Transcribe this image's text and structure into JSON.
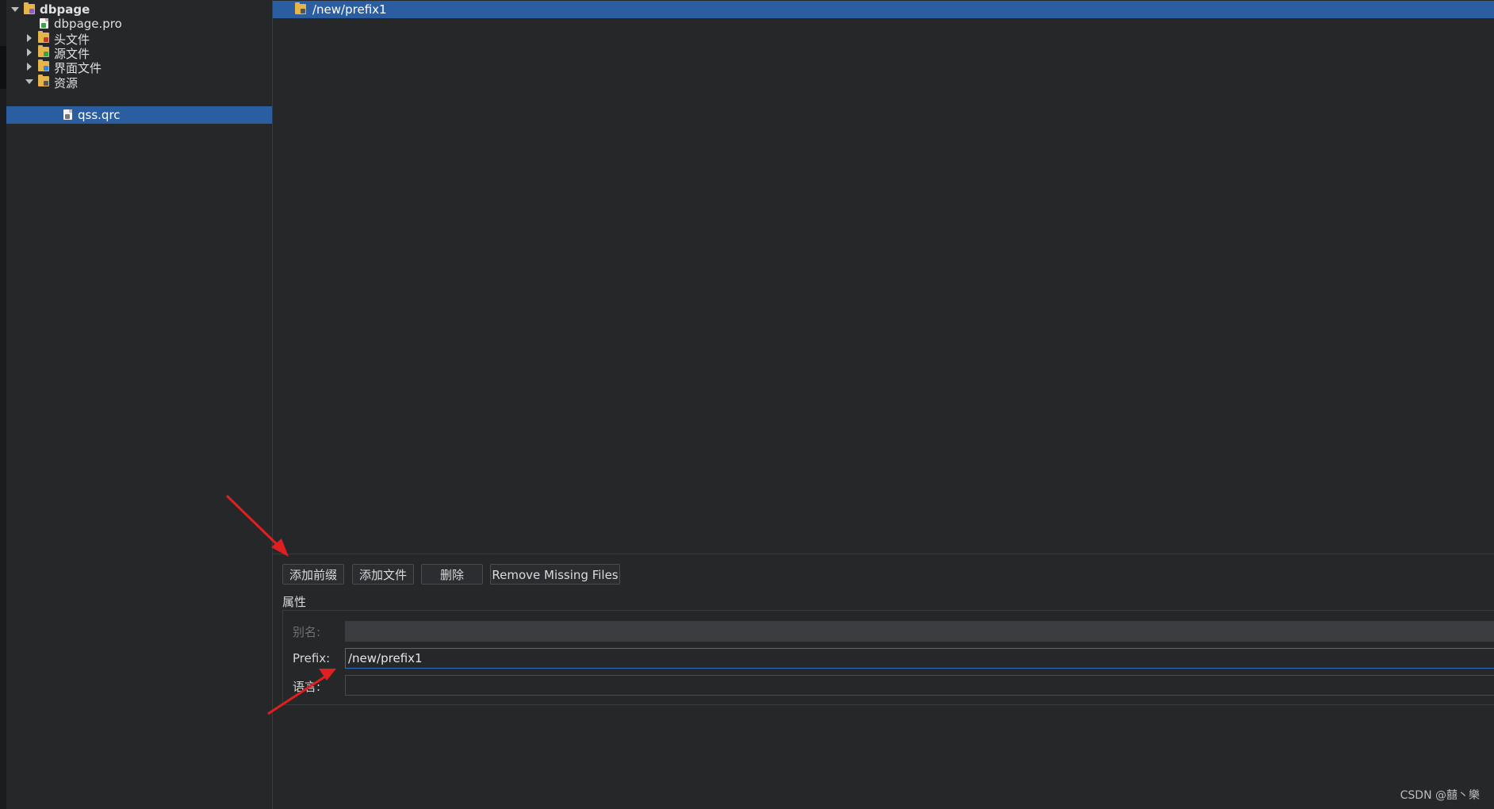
{
  "colors": {
    "accent": "#2b5ea0",
    "background": "#262729",
    "annotation": "#e02020"
  },
  "tree": {
    "items": [
      {
        "label": "dbpage",
        "expanded": true,
        "icon": "project-folder-icon"
      },
      {
        "label": "dbpage.pro",
        "icon": "pro-file-icon"
      },
      {
        "label": "头文件",
        "expanded": false,
        "icon": "headers-folder-icon"
      },
      {
        "label": "源文件",
        "expanded": false,
        "icon": "sources-folder-icon"
      },
      {
        "label": "界面文件",
        "expanded": false,
        "icon": "forms-folder-icon"
      },
      {
        "label": "资源",
        "expanded": true,
        "icon": "resources-folder-icon"
      },
      {
        "label": "qss.qrc",
        "selected": true,
        "icon": "qrc-file-icon"
      }
    ]
  },
  "resource_tree": {
    "prefix": "/new/prefix1"
  },
  "buttons": {
    "add_prefix": "添加前缀",
    "add_files": "添加文件",
    "delete": "删除",
    "remove_missing": "Remove Missing Files"
  },
  "properties": {
    "title": "属性",
    "alias_label": "别名:",
    "alias_value": "",
    "prefix_label": "Prefix:",
    "prefix_value": "/new/prefix1",
    "language_label": "语言:",
    "language_value": ""
  },
  "watermark": "CSDN @囍丶樂"
}
